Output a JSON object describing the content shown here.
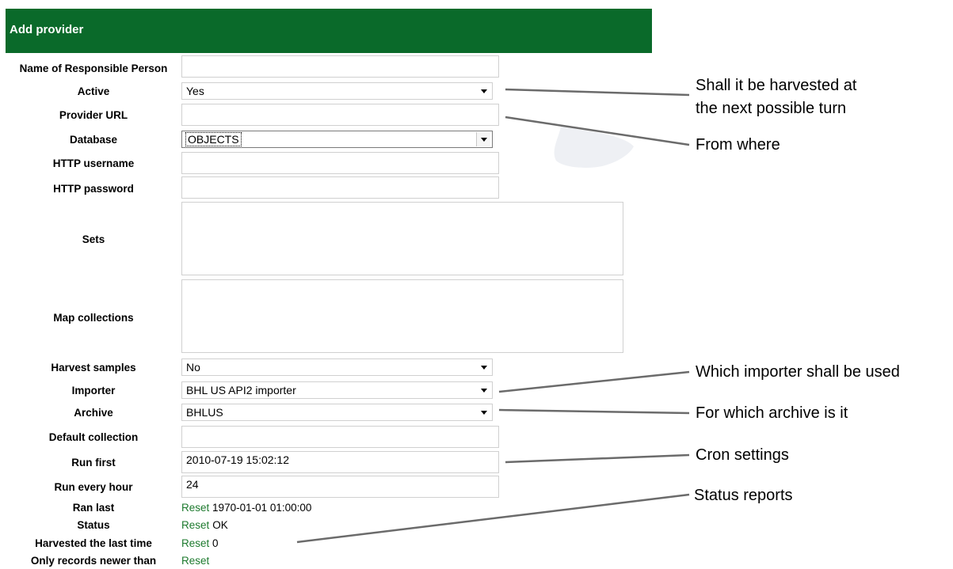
{
  "header": {
    "title": "Add provider"
  },
  "labels": {
    "responsible": "Name of Responsible Person",
    "active": "Active",
    "provider_url": "Provider URL",
    "database": "Database",
    "http_username": "HTTP username",
    "http_password": "HTTP password",
    "sets": "Sets",
    "map_collections": "Map collections",
    "harvest_samples": "Harvest samples",
    "importer": "Importer",
    "archive": "Archive",
    "default_collection": "Default collection",
    "run_first": "Run first",
    "run_every_hour": "Run every hour",
    "ran_last": "Ran last",
    "status": "Status",
    "harvested_last": "Harvested the last time",
    "only_newer": "Only records newer than"
  },
  "values": {
    "active": "Yes",
    "database": "OBJECTS",
    "harvest_samples": "No",
    "importer": "BHL US API2 importer",
    "archive": "BHLUS",
    "run_first": "2010-07-19 15:02:12",
    "run_every_hour": "24",
    "ran_last": "1970-01-01 01:00:00",
    "status": "OK",
    "harvested_last": "0"
  },
  "reset_label": "Reset",
  "annotations": {
    "harvest_next_line1": "Shall it be harvested at",
    "harvest_next_line2": "the next possible turn",
    "from_where": "From where",
    "which_importer": "Which importer shall be used",
    "which_archive": "For which archive is it",
    "cron": "Cron settings",
    "status_reports": "Status reports"
  },
  "colors": {
    "header_bg": "#0a6a2a",
    "reset_link": "#1d7a2e",
    "annotation_line": "#6b6b6b"
  }
}
